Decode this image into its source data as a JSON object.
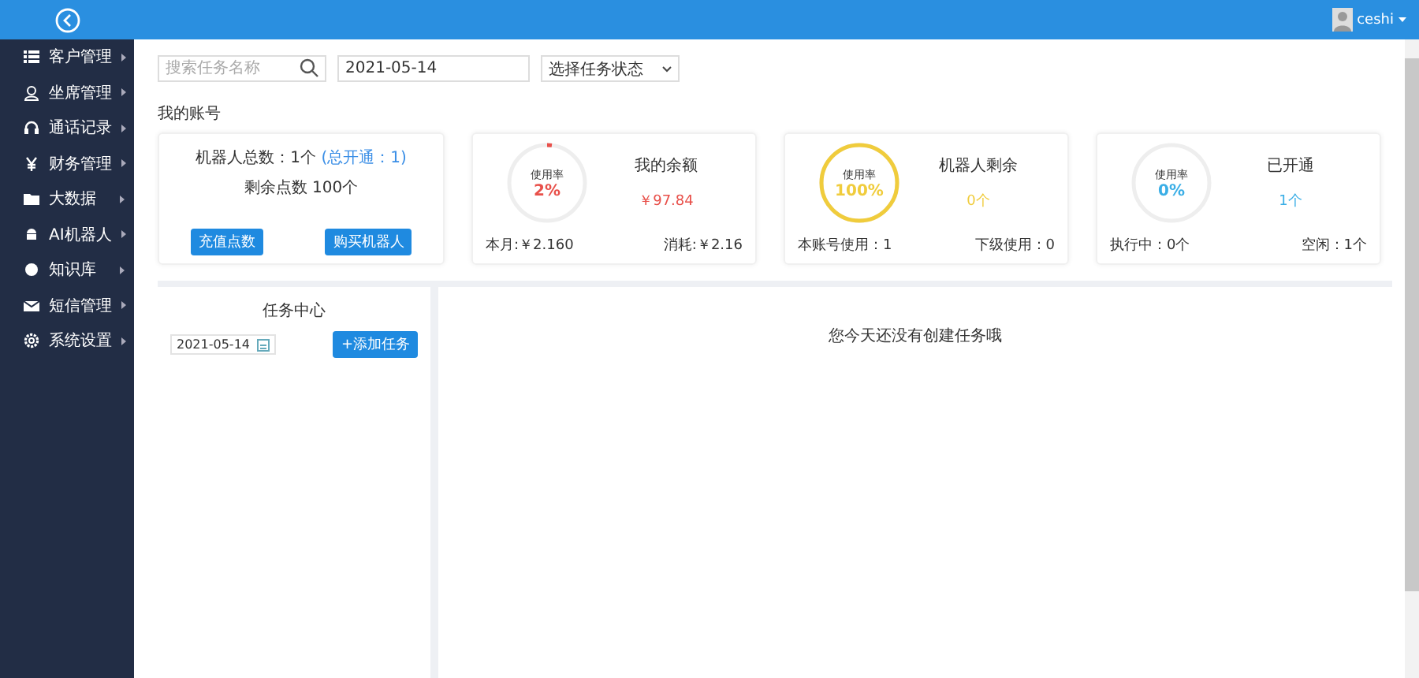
{
  "header": {
    "username": "ceshi"
  },
  "sidebar": {
    "items": [
      {
        "label": "客户管理",
        "kind": "list"
      },
      {
        "label": "坐席管理",
        "kind": "people"
      },
      {
        "label": "通话记录",
        "kind": "headset"
      },
      {
        "label": "财务管理",
        "kind": "yen"
      },
      {
        "label": "大数据",
        "kind": "folder"
      },
      {
        "label": "AI机器人",
        "kind": "android"
      },
      {
        "label": "知识库",
        "kind": "dot"
      },
      {
        "label": "短信管理",
        "kind": "mail"
      },
      {
        "label": "系统设置",
        "kind": "gear"
      }
    ]
  },
  "filters": {
    "search_placeholder": "搜索任务名称",
    "date": "2021-05-14",
    "status_select": "选择任务状态"
  },
  "section_title": "我的账号",
  "account_card": {
    "robots_total": "机器人总数：1个",
    "robots_open": "(总开通：1)",
    "points": "剩余点数 100个",
    "buttons": [
      "充值点数",
      "购买机器人"
    ]
  },
  "stat_cards": [
    {
      "gauge_label": "使用率",
      "percent": "2%",
      "level": 0.02,
      "color": "#e8504a",
      "title": "我的余额",
      "value": "￥97.84",
      "footer": [
        "本月:￥2.160",
        "消耗:￥2.16"
      ]
    },
    {
      "gauge_label": "使用率",
      "percent": "100%",
      "level": 1,
      "color": "#f0cc3c",
      "title": "机器人剩余",
      "value": "0个",
      "footer": [
        "本账号使用：1",
        "下级使用：0"
      ]
    },
    {
      "gauge_label": "使用率",
      "percent": "0%",
      "level": 0,
      "color": "#3aaee6",
      "title": "已开通",
      "value": "1个",
      "footer": [
        "执行中：0个",
        "空闲：1个"
      ]
    }
  ],
  "task_center": {
    "title": "任务中心",
    "date": "2021-05-14",
    "add_button": "+添加任务"
  },
  "empty_message": "您今天还没有创建任务哦"
}
